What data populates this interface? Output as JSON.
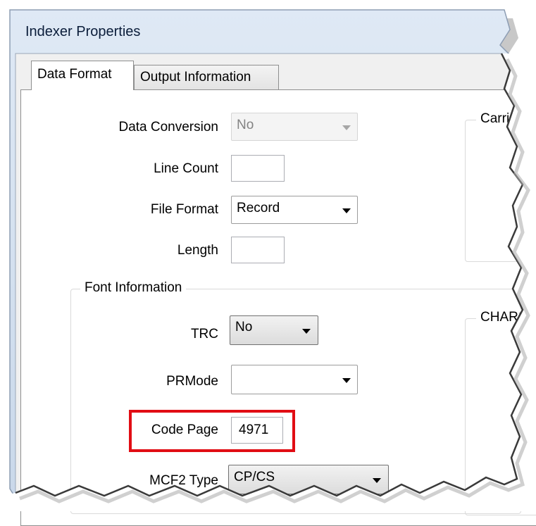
{
  "window": {
    "title": "Indexer Properties"
  },
  "tabs": [
    {
      "label": "Data Format",
      "active": true
    },
    {
      "label": "Output Information",
      "active": false
    }
  ],
  "fields": {
    "data_conversion": {
      "label": "Data Conversion",
      "value": "No",
      "enabled": false
    },
    "line_count": {
      "label": "Line Count",
      "value": ""
    },
    "file_format": {
      "label": "File Format",
      "value": "Record"
    },
    "length": {
      "label": "Length",
      "value": ""
    }
  },
  "font_information": {
    "title": "Font Information",
    "trc": {
      "label": "TRC",
      "value": "No"
    },
    "prmode": {
      "label": "PRMode",
      "value": ""
    },
    "code_page": {
      "label": "Code Page",
      "value": "4971",
      "highlighted": true
    },
    "mcf2_type": {
      "label": "MCF2 Type",
      "value": "CP/CS"
    }
  },
  "right_groups": {
    "carriage_control_title_partial": "Carri",
    "chars_title_partial": "CHARS"
  },
  "colors": {
    "highlight": "#e10d14",
    "title_text": "#0b1d3a",
    "frame_border": "#a9b4c3"
  }
}
